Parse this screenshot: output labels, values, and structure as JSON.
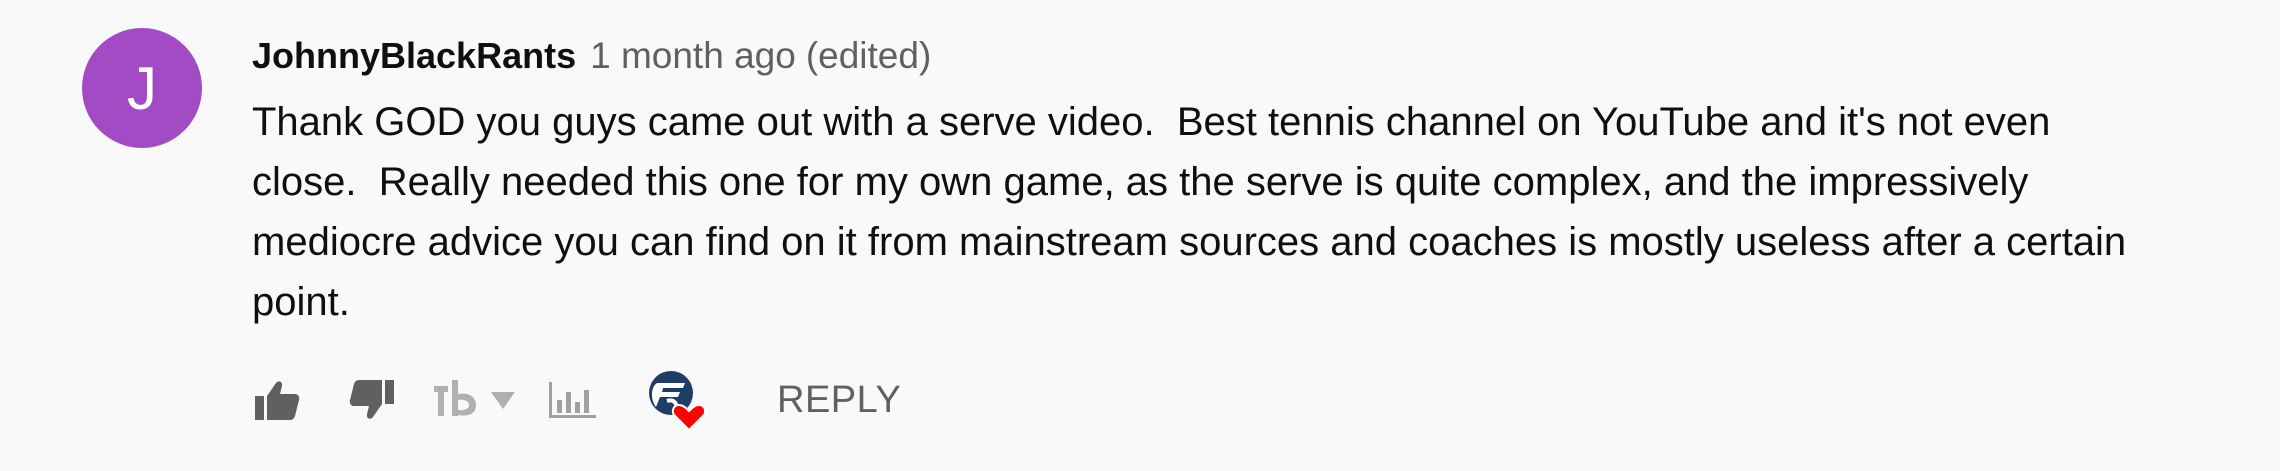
{
  "comment": {
    "avatar_initial": "J",
    "avatar_color": "#a34bc4",
    "author": "JohnnyBlackRants",
    "time": "1 month ago",
    "edited": "(edited)",
    "text": "Thank GOD you guys came out with a serve video.  Best tennis channel on YouTube and it's not even close.  Really needed this one for my own game, as the serve is quite complex, and the impressively mediocre advice you can find on it from mainstream sources and coaches is mostly useless after a certain point."
  },
  "toolbar": {
    "like_icon": "thumb-up-icon",
    "dislike_icon": "thumb-down-icon",
    "extension_icon": "tb-extension-icon",
    "stats_icon": "bar-chart-icon",
    "creator_heart_icon": "creator-heart-icon",
    "reply_label": "REPLY",
    "icon_color": "#606060",
    "heart_color": "#ff0000"
  }
}
